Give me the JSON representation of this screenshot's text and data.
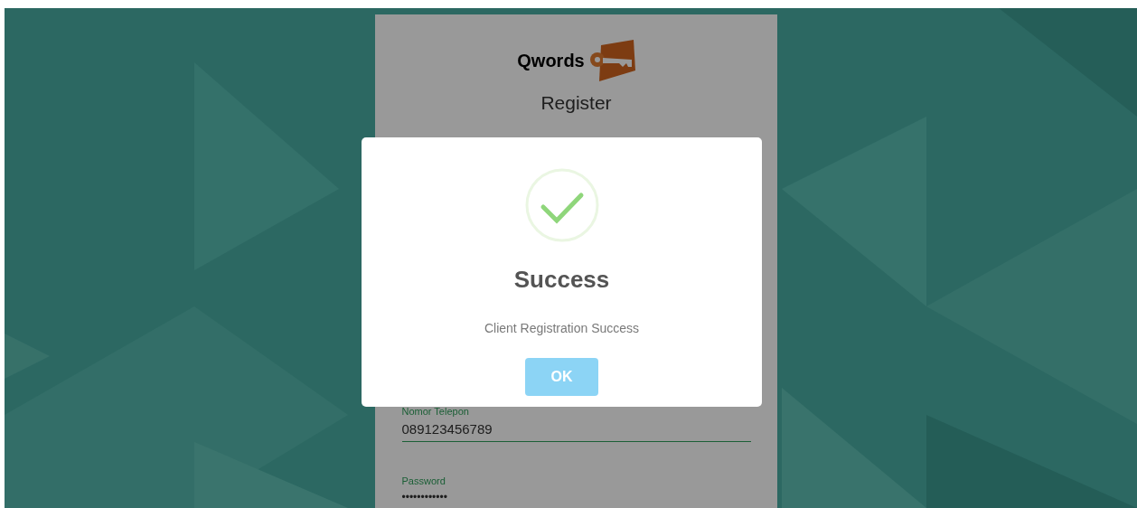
{
  "brand": {
    "name": "Qwords"
  },
  "form": {
    "title": "Register",
    "fields": [
      {
        "label": "Nomor Telepon",
        "value": "089123456789",
        "kind": "text"
      },
      {
        "label": "Password",
        "value": "••••••••••••",
        "kind": "password"
      }
    ]
  },
  "dialog": {
    "title": "Success",
    "message": "Client Registration Success",
    "button": "OK"
  }
}
